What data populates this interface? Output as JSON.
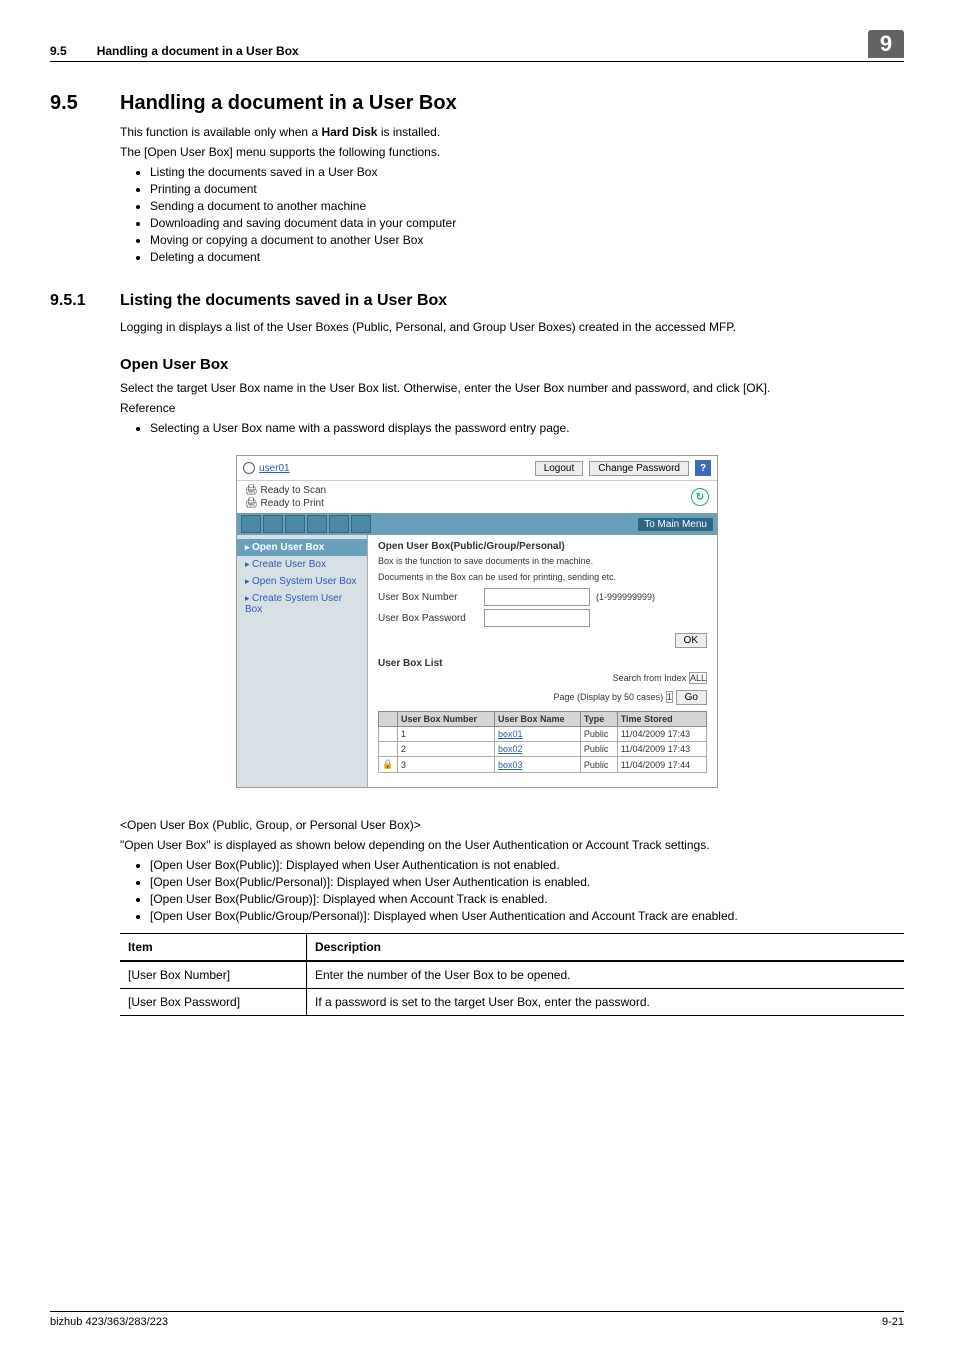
{
  "header": {
    "section_number": "9.5",
    "section_title": "Handling a document in a User Box",
    "chapter": "9"
  },
  "main_heading": {
    "num": "9.5",
    "title": "Handling a document in a User Box"
  },
  "intro": {
    "p1_prefix": "This function is available only when a ",
    "p1_bold": "Hard Disk",
    "p1_suffix": " is installed.",
    "p2": "The [Open User Box] menu supports the following functions.",
    "bullets": [
      "Listing the documents saved in a User Box",
      "Printing a document",
      "Sending a document to another machine",
      "Downloading and saving document data in your computer",
      "Moving or copying a document to another User Box",
      "Deleting a document"
    ]
  },
  "sub1": {
    "num": "9.5.1",
    "title": "Listing the documents saved in a User Box",
    "p": "Logging in displays a list of the User Boxes (Public, Personal, and Group User Boxes) created in the accessed MFP."
  },
  "open_box": {
    "title": "Open User Box",
    "p": "Select the target User Box name in the User Box list. Otherwise, enter the User Box number and password, and click [OK].",
    "ref_label": "Reference",
    "ref_bullet": "Selecting a User Box name with a password displays the password entry page."
  },
  "screenshot": {
    "user": "user01",
    "logout": "Logout",
    "change_pw": "Change Password",
    "help": "?",
    "status_scan": "Ready to Scan",
    "status_print": "Ready to Print",
    "refresh": "↻",
    "to_main": "To Main Menu",
    "side": {
      "open": "Open User Box",
      "create": "Create User Box",
      "open_sys": "Open System User Box",
      "create_sys": "Create System User Box"
    },
    "panel": {
      "title": "Open User Box(Public/Group/Personal)",
      "desc1": "Box is the function to save documents in the machine.",
      "desc2": "Documents in the Box can be used for printing, sending etc.",
      "num_label": "User Box Number",
      "num_range": "(1-999999999)",
      "pw_label": "User Box Password",
      "ok": "OK",
      "list_title": "User Box List",
      "search_label": "Search from Index",
      "search_val": "ALL",
      "page_label": "Page (Display by 50 cases)",
      "page_val": "1",
      "go": "Go",
      "cols": {
        "num": "User Box Number",
        "name": "User Box Name",
        "type": "Type",
        "time": "Time Stored"
      },
      "rows": [
        {
          "lock": "",
          "num": "1",
          "name": "box01",
          "type": "Public",
          "time": "11/04/2009 17:43"
        },
        {
          "lock": "",
          "num": "2",
          "name": "box02",
          "type": "Public",
          "time": "11/04/2009 17:43"
        },
        {
          "lock": "🔒",
          "num": "3",
          "name": "box03",
          "type": "Public",
          "time": "11/04/2009 17:44"
        }
      ]
    }
  },
  "below_shot": {
    "angle_line": "<Open User Box (Public, Group, or Personal User Box)>",
    "p": "\"Open User Box\" is displayed as shown below depending on the User Authentication or Account Track settings.",
    "bullets": [
      "[Open User Box(Public)]: Displayed when User Authentication is not enabled.",
      "[Open User Box(Public/Personal)]: Displayed when User Authentication is enabled.",
      "[Open User Box(Public/Group)]: Displayed when Account Track is enabled.",
      "[Open User Box(Public/Group/Personal)]: Displayed when User Authentication and Account Track are enabled."
    ]
  },
  "desc_table": {
    "head": {
      "item": "Item",
      "desc": "Description"
    },
    "rows": [
      {
        "item": "[User Box Number]",
        "desc": "Enter the number of the User Box to be opened."
      },
      {
        "item": "[User Box Password]",
        "desc": "If a password is set to the target User Box, enter the password."
      }
    ]
  },
  "footer": {
    "left": "bizhub 423/363/283/223",
    "right": "9-21"
  }
}
